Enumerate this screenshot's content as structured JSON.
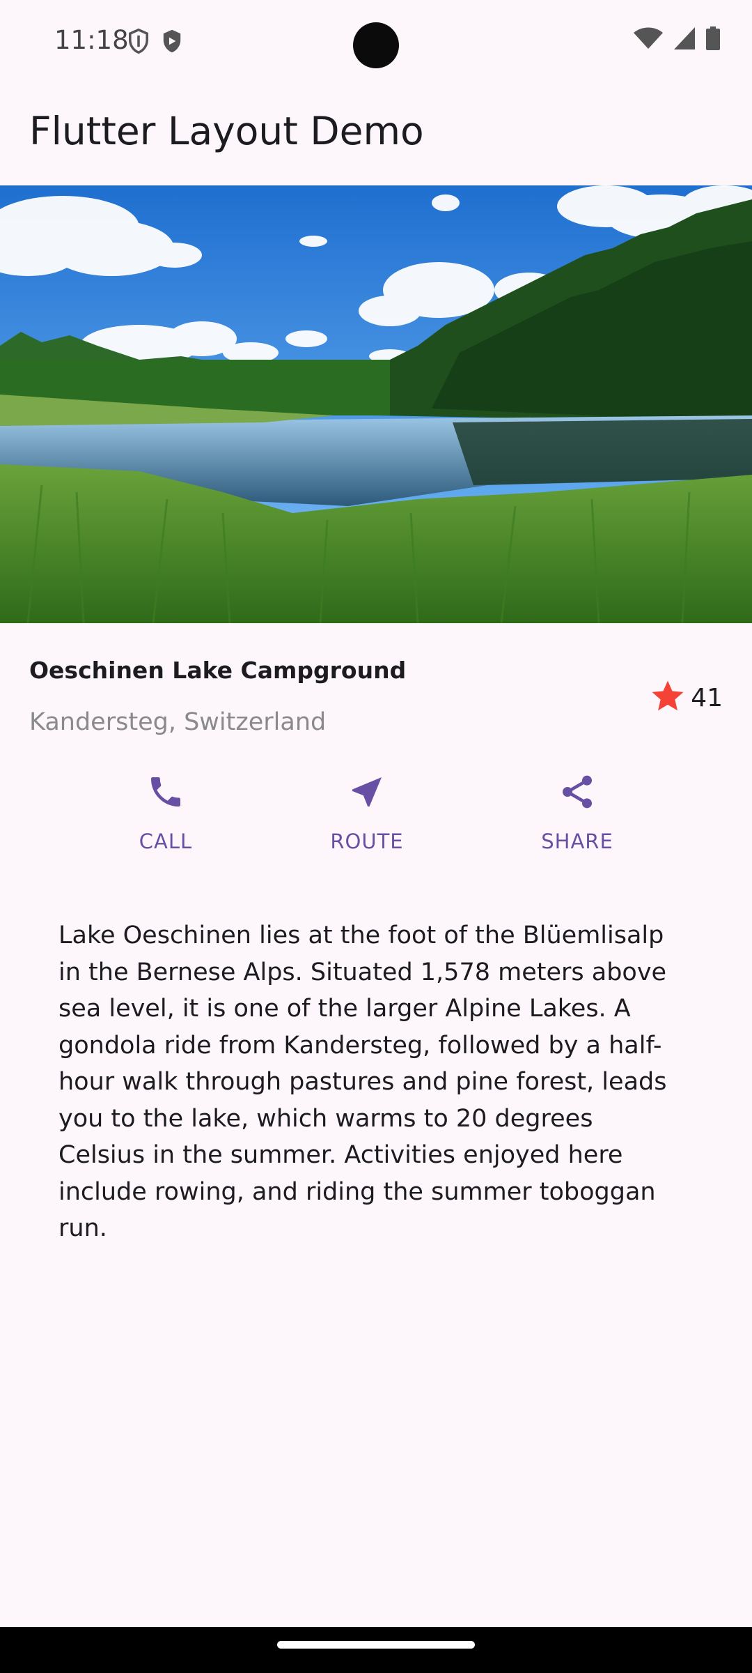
{
  "status_bar": {
    "time": "11:18",
    "left_icons": [
      "shield-outline-icon",
      "shield-filled-icon"
    ],
    "right_icons": [
      "wifi-icon",
      "cell-signal-icon",
      "battery-icon"
    ]
  },
  "app_bar": {
    "title": "Flutter Layout Demo"
  },
  "hero_image": {
    "description_icon": "landscape-photo"
  },
  "title_section": {
    "name": "Oeschinen Lake Campground",
    "location": "Kandersteg, Switzerland",
    "rating_count": "41",
    "star_color": "#f44336"
  },
  "buttons": [
    {
      "label": "CALL",
      "icon": "phone-icon"
    },
    {
      "label": "ROUTE",
      "icon": "navigation-icon"
    },
    {
      "label": "SHARE",
      "icon": "share-icon"
    }
  ],
  "accent_color": "#6750a4",
  "description": "Lake Oeschinen lies at the foot of the Blüemlisalp in the Bernese Alps. Situated 1,578 meters above sea level, it is one of the larger Alpine Lakes. A gondola ride from Kandersteg, followed by a half-hour walk through pastures and pine forest, leads you to the lake, which warms to 20 degrees Celsius in the summer. Activities enjoyed here include rowing, and riding the summer toboggan run."
}
